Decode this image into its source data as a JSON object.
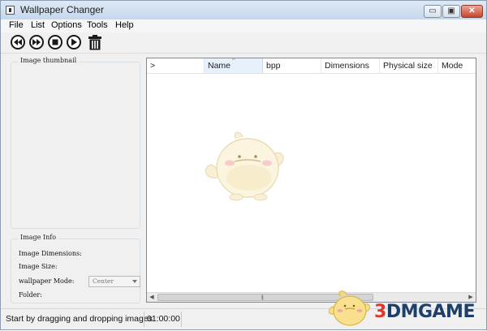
{
  "window": {
    "title": "Wallpaper Changer"
  },
  "title_buttons": {
    "minimize": "▭",
    "maximize": "▣",
    "close": "✕"
  },
  "menu": {
    "items": [
      {
        "label": "File"
      },
      {
        "label": "List"
      },
      {
        "label": "Options"
      },
      {
        "label": "Tools"
      },
      {
        "label": "Help"
      }
    ]
  },
  "toolbar": {
    "buttons": [
      {
        "icon": "previous-icon"
      },
      {
        "icon": "next-icon"
      },
      {
        "icon": "stop-icon"
      },
      {
        "icon": "play-icon"
      },
      {
        "icon": "trash-icon"
      }
    ]
  },
  "left_panel": {
    "thumbnail_title": "Image thumbnail",
    "info_title": "Image Info",
    "dimensions_label": "Image Dimensions:",
    "size_label": "Image Size:",
    "mode_label": "wallpaper Mode:",
    "mode_value": "Center",
    "folder_label": "Folder:"
  },
  "list": {
    "columns": [
      {
        "label": ">"
      },
      {
        "label": "Name",
        "sorted": true
      },
      {
        "label": "bpp"
      },
      {
        "label": "Dimensions"
      },
      {
        "label": "Physical size"
      },
      {
        "label": "Mode"
      }
    ],
    "sort_indicator": "^",
    "scroll_left": "◀",
    "scroll_right": "▶",
    "scroll_grip": "|||"
  },
  "status": {
    "message": "Start by dragging and dropping images",
    "time": "01:00:00"
  },
  "watermark": {
    "prefix": "3",
    "text": "DMGAME"
  },
  "colors": {
    "titlebar": "#c5d7ec",
    "close_button": "#c6452c",
    "watermark_blue": "#1c3f6b",
    "watermark_red": "#e1362b"
  }
}
